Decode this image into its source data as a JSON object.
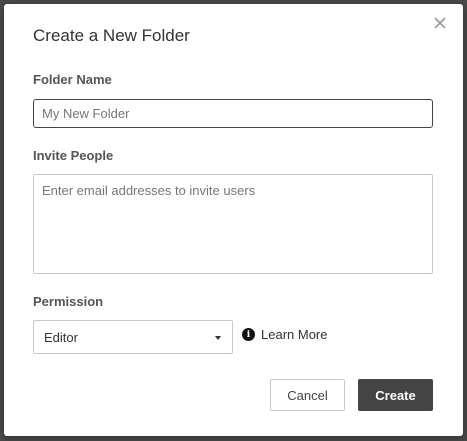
{
  "dialog": {
    "title": "Create a New Folder",
    "close_icon": "close-icon"
  },
  "folder_name": {
    "label": "Folder Name",
    "placeholder": "My New Folder",
    "value": ""
  },
  "invite": {
    "label": "Invite People",
    "placeholder": "Enter email addresses to invite users",
    "value": ""
  },
  "permission": {
    "label": "Permission",
    "selected": "Editor",
    "dropdown_icon": "caret-down-icon",
    "learn_more_icon": "info-icon",
    "learn_more": "Learn More"
  },
  "actions": {
    "cancel": "Cancel",
    "create": "Create"
  },
  "colors": {
    "primary_button": "#444444",
    "backdrop": "#4a4a4a"
  }
}
